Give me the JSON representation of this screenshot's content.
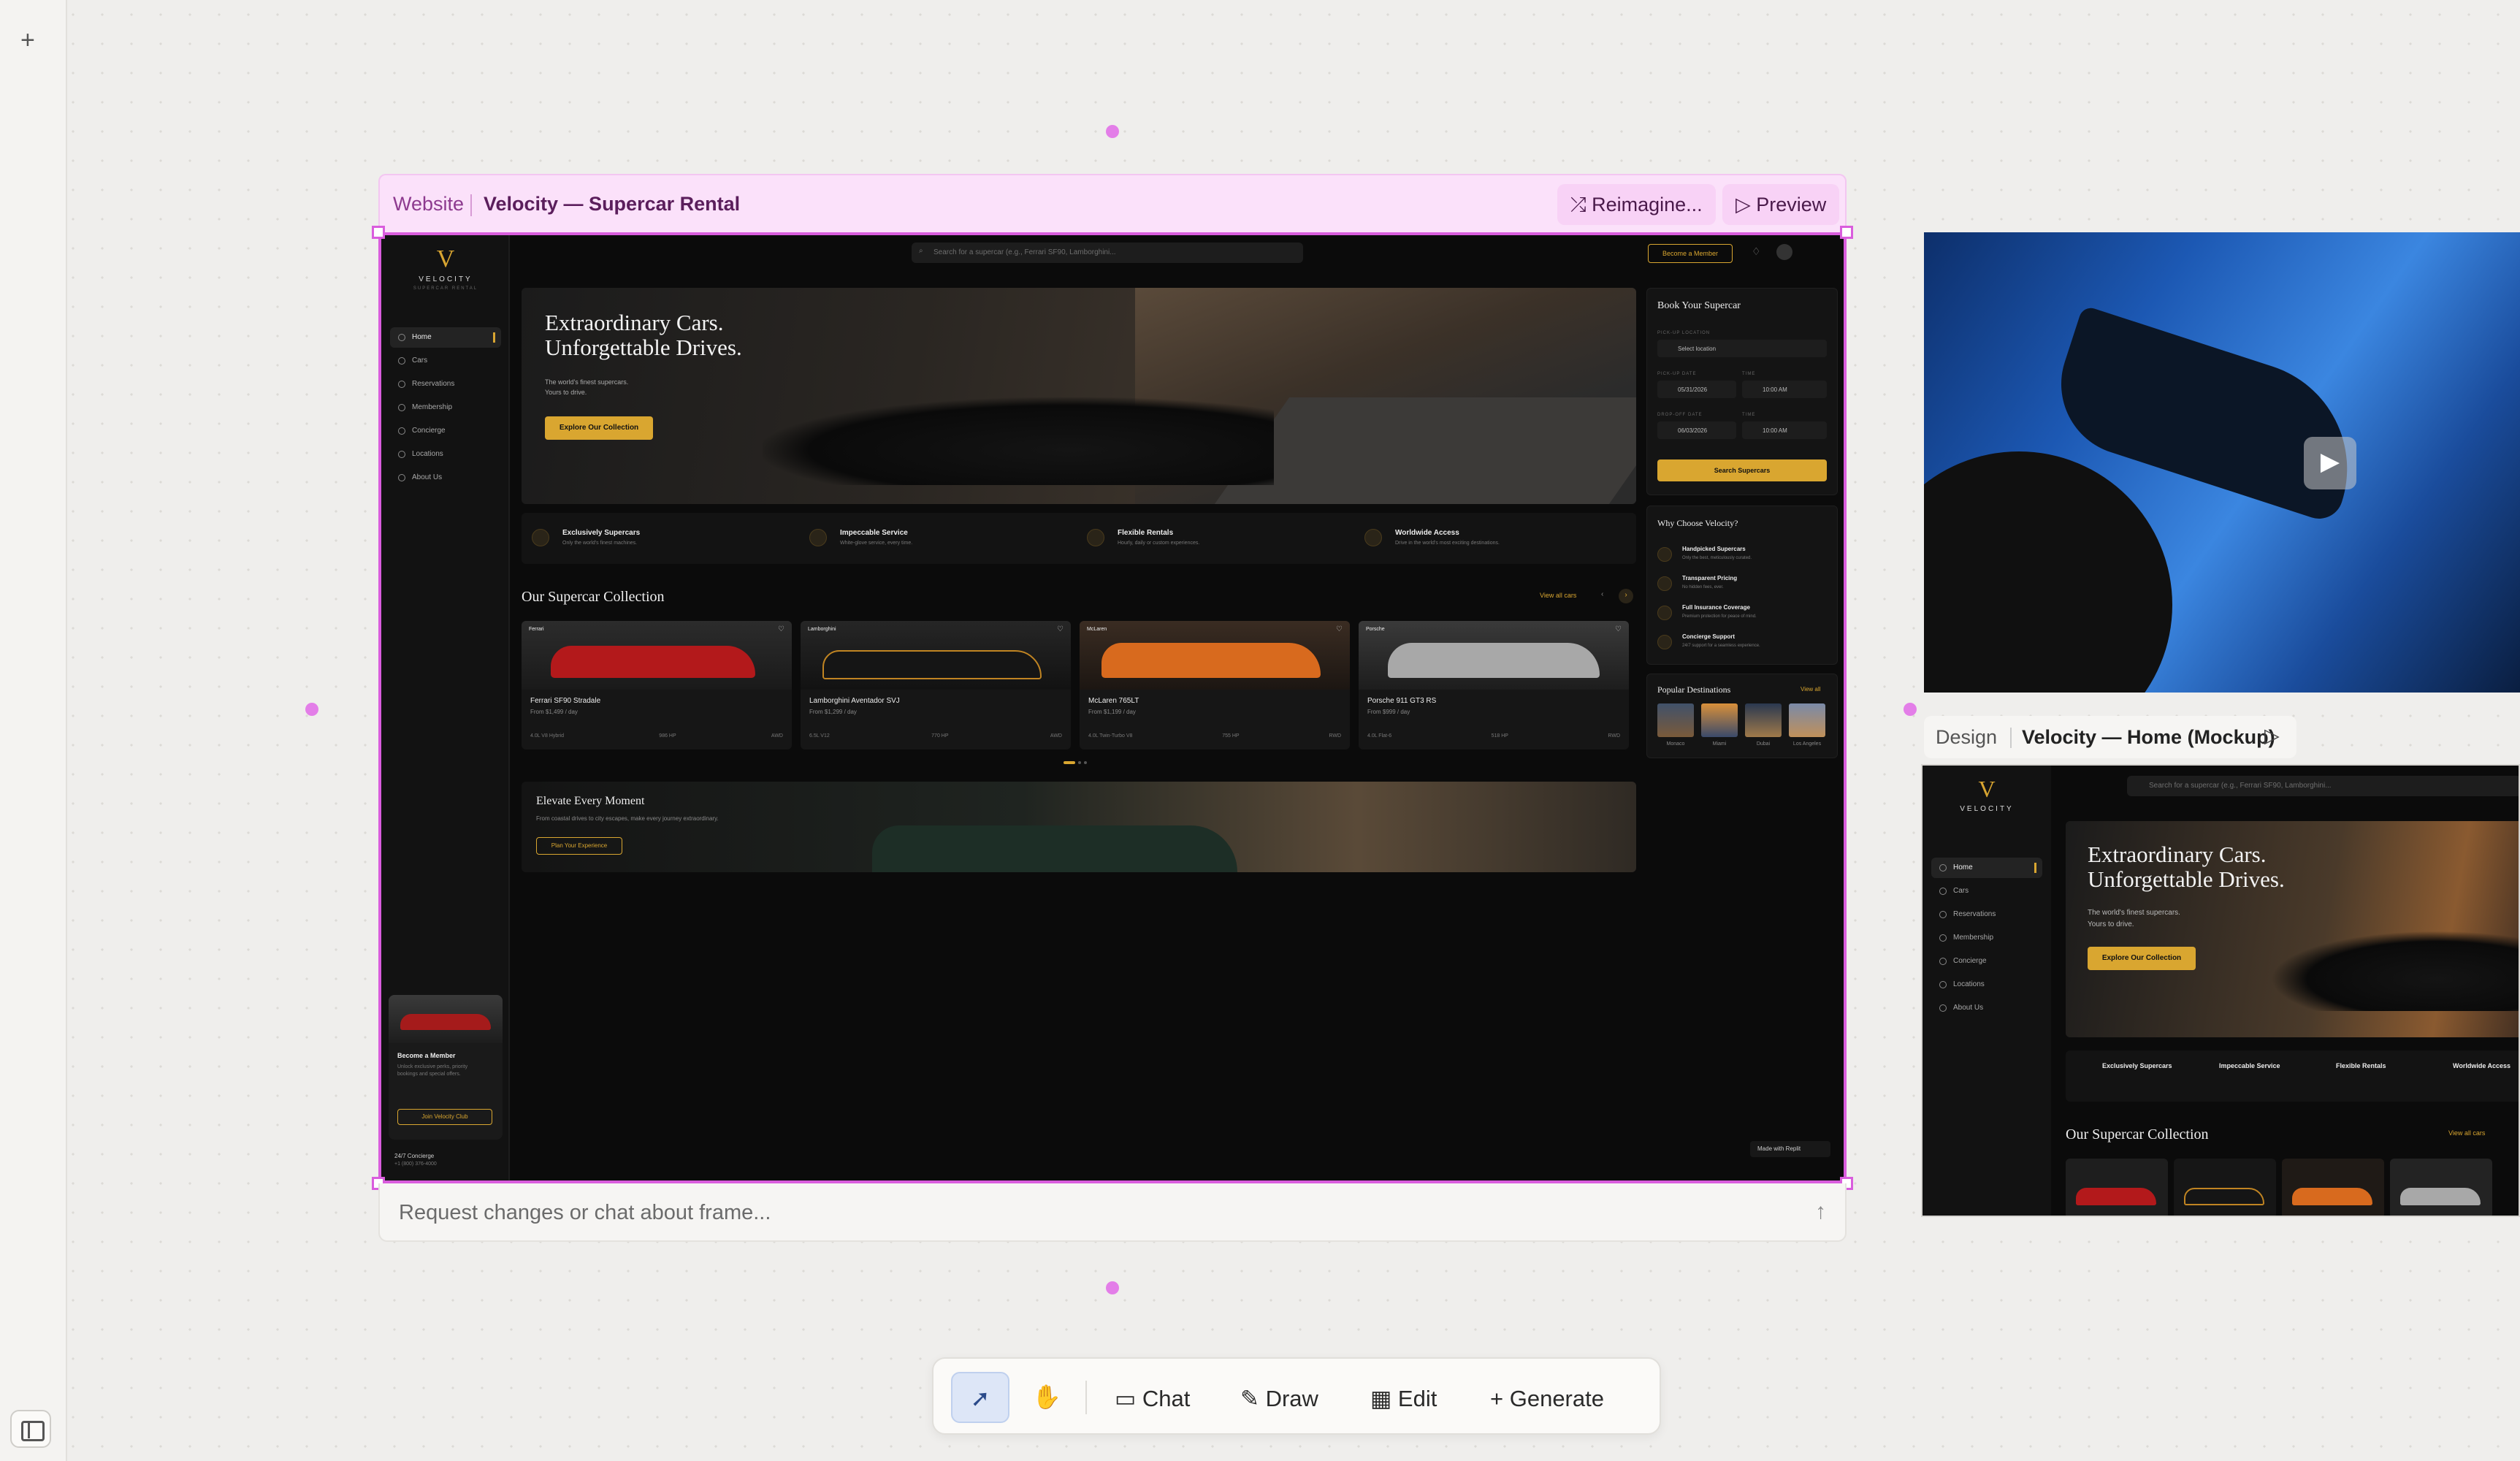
{
  "app": {
    "add_label": "+"
  },
  "frame": {
    "kind": "Website",
    "name": "Velocity — Supercar Rental",
    "reimagine": "Reimagine...",
    "preview": "Preview",
    "chat_placeholder": "Request changes or chat about frame..."
  },
  "site": {
    "logo": "V",
    "brand": "VELOCITY",
    "tagline": "SUPERCAR RENTAL",
    "nav": [
      "Home",
      "Cars",
      "Reservations",
      "Membership",
      "Concierge",
      "Locations",
      "About Us"
    ],
    "search_placeholder": "Search for a supercar (e.g., Ferrari SF90, Lamborghini...",
    "become_member": "Become a Member",
    "hero": {
      "title1": "Extraordinary Cars.",
      "title2": "Unforgettable Drives.",
      "sub1": "The world's finest supercars.",
      "sub2": "Yours to drive.",
      "cta": "Explore Our Collection"
    },
    "features": [
      {
        "t": "Exclusively Supercars",
        "d": "Only the world's finest machines."
      },
      {
        "t": "Impeccable Service",
        "d": "White-glove service, every time."
      },
      {
        "t": "Flexible Rentals",
        "d": "Hourly, daily or custom experiences."
      },
      {
        "t": "Worldwide Access",
        "d": "Drive in the world's most exciting destinations."
      }
    ],
    "collection": {
      "title": "Our Supercar Collection",
      "view_all": "View all cars"
    },
    "cars": [
      {
        "tag": "Ferrari",
        "name": "Ferrari SF90 Stradale",
        "price": "From $1,499 / day",
        "s1": "4.0L V8 Hybrid",
        "s2": "986 HP",
        "s3": "AWD"
      },
      {
        "tag": "Lamborghini",
        "name": "Lamborghini Aventador SVJ",
        "price": "From $1,299 / day",
        "s1": "6.5L V12",
        "s2": "770 HP",
        "s3": "AWD"
      },
      {
        "tag": "McLaren",
        "name": "McLaren 765LT",
        "price": "From $1,199 / day",
        "s1": "4.0L Twin-Turbo V8",
        "s2": "755 HP",
        "s3": "RWD"
      },
      {
        "tag": "Porsche",
        "name": "Porsche 911 GT3 RS",
        "price": "From $999 / day",
        "s1": "4.0L Flat-6",
        "s2": "518 HP",
        "s3": "RWD"
      }
    ],
    "elevate": {
      "title": "Elevate Every Moment",
      "sub": "From coastal drives to city escapes, make every journey extraordinary.",
      "cta": "Plan Your Experience"
    },
    "booking": {
      "title": "Book Your Supercar",
      "pickup_loc_label": "PICK-UP LOCATION",
      "pickup_loc": "Select location",
      "pickup_date_label": "PICK-UP DATE",
      "time_label": "TIME",
      "pickup_date": "05/31/2026",
      "pickup_time": "10:00 AM",
      "dropoff_date_label": "DROP-OFF DATE",
      "dropoff_date": "06/03/2026",
      "dropoff_time": "10:00 AM",
      "cta": "Search Supercars"
    },
    "why": {
      "title": "Why Choose Velocity?",
      "items": [
        {
          "t": "Handpicked Supercars",
          "d": "Only the best, meticulously curated."
        },
        {
          "t": "Transparent Pricing",
          "d": "No hidden fees, ever."
        },
        {
          "t": "Full Insurance Coverage",
          "d": "Premium protection for peace of mind."
        },
        {
          "t": "Concierge Support",
          "d": "24/7 support for a seamless experience."
        }
      ]
    },
    "destinations": {
      "title": "Popular Destinations",
      "view_all": "View all",
      "items": [
        "Monaco",
        "Miami",
        "Dubai",
        "Los Angeles"
      ]
    },
    "member_card": {
      "title": "Become a Member",
      "desc": "Unlock exclusive perks, priority bookings and special offers.",
      "cta": "Join Velocity Club"
    },
    "concierge": {
      "title": "24/7 Concierge",
      "phone": "+1 (800) 376-4000"
    },
    "made_with": "Made with Replit"
  },
  "design": {
    "kind": "Design",
    "name": "Velocity — Home (Mockup)"
  },
  "toolbar": {
    "chat": "Chat",
    "draw": "Draw",
    "edit": "Edit",
    "generate": "Generate"
  },
  "colors": {
    "accent": "#d9a630",
    "selection": "#d95ddd"
  }
}
